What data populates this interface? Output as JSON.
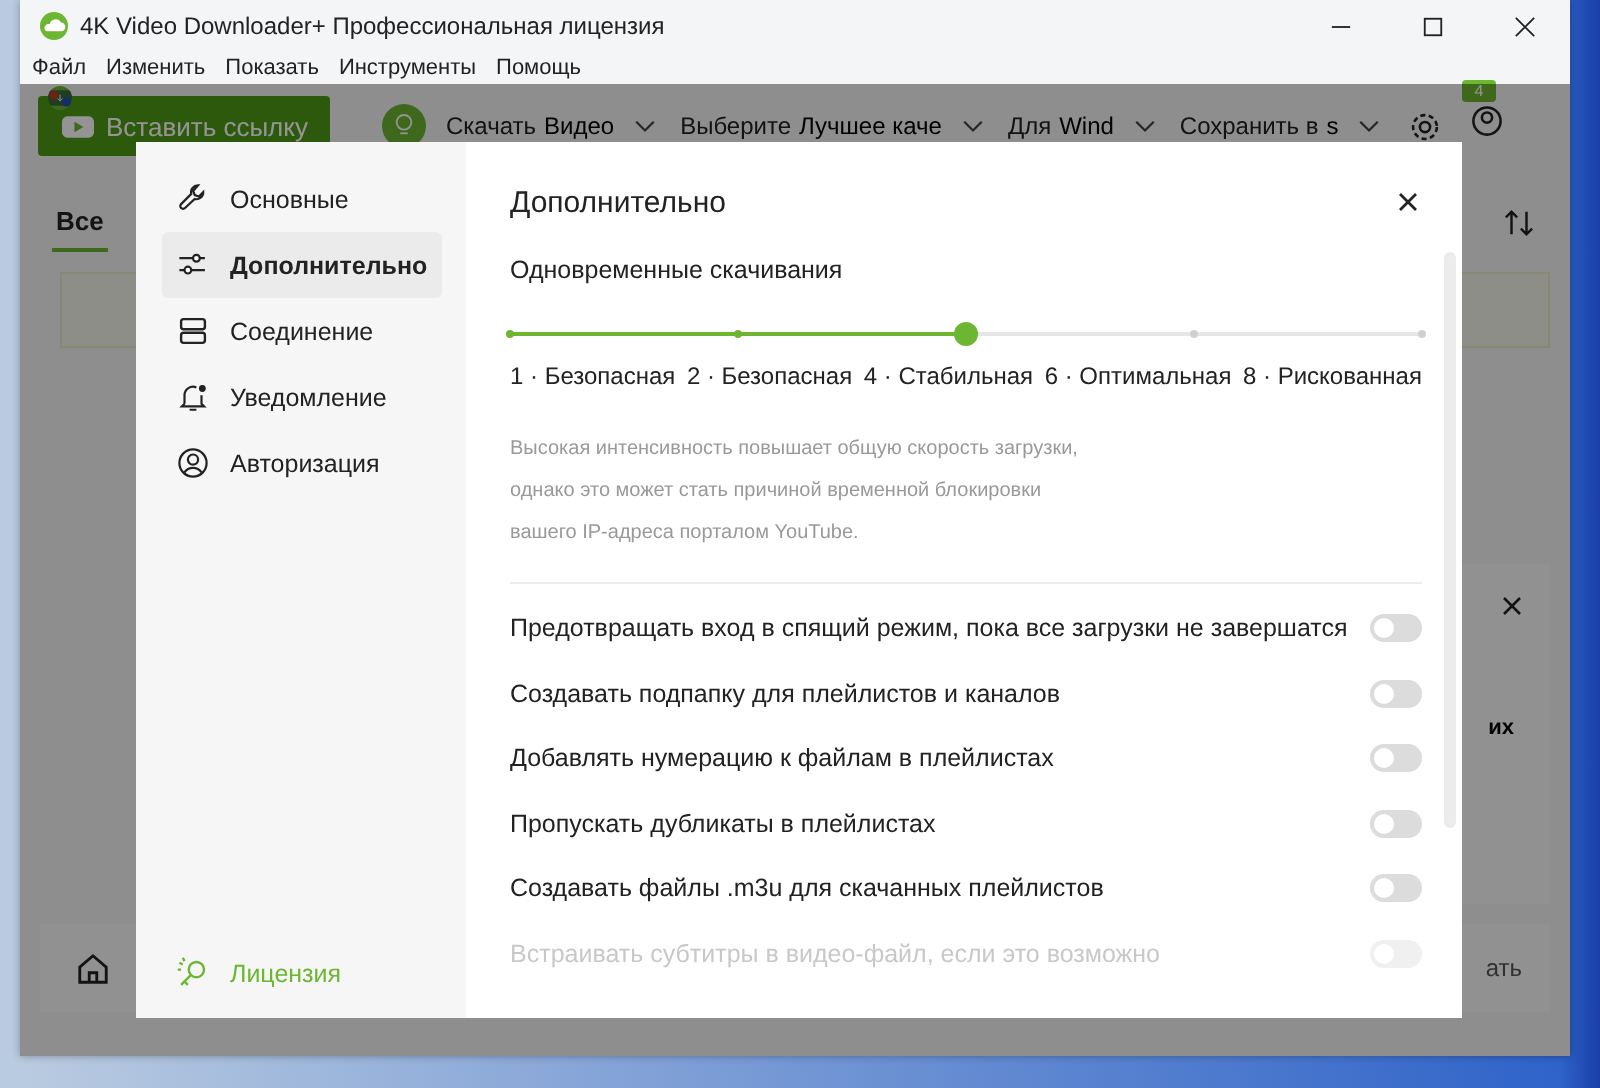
{
  "window": {
    "title": "4K Video Downloader+ Профессиональная лицензия"
  },
  "menu": [
    "Файл",
    "Изменить",
    "Показать",
    "Инструменты",
    "Помощь"
  ],
  "background_app": {
    "paste_button": "Вставить ссылку",
    "options": [
      {
        "label": "Скачать",
        "value": "Видео"
      },
      {
        "label": "Выберите",
        "value": "Лучшее каче"
      },
      {
        "label": "Для",
        "value": "Wind"
      },
      {
        "label": "Сохранить в",
        "value": "s"
      }
    ],
    "badge": "4",
    "tabs": [
      {
        "label": "Все",
        "selected": true
      }
    ],
    "panel_text": "их",
    "bottom_button": "ать"
  },
  "dialog": {
    "sidebar": {
      "items": [
        {
          "label": "Основные",
          "selected": false
        },
        {
          "label": "Дополнительно",
          "selected": true
        },
        {
          "label": "Соединение",
          "selected": false
        },
        {
          "label": "Уведомление",
          "selected": false
        },
        {
          "label": "Авторизация",
          "selected": false
        }
      ],
      "license": "Лицензия"
    },
    "title": "Дополнительно",
    "slider": {
      "label": "Одновременные скачивания",
      "level": 0.5,
      "stops": [
        "1 · Безопасная",
        "2 · Безопасная",
        "4 · Стабильная",
        "6 · Оптимальная",
        "8 · Рискованная"
      ]
    },
    "note": "Высокая интенсивность повышает общую скорость загрузки, однако это может стать причиной временной блокировки вашего IP-адреса порталом YouTube.",
    "toggles": [
      {
        "label": "Предотвращать вход в спящий режим, пока все загрузки не завершатся",
        "on": false,
        "disabled": false
      },
      {
        "label": "Создавать подпапку для плейлистов и каналов",
        "on": false,
        "disabled": false
      },
      {
        "label": "Добавлять нумерацию к файлам в плейлистах",
        "on": false,
        "disabled": false
      },
      {
        "label": "Пропускать дубликаты в плейлистах",
        "on": false,
        "disabled": false
      },
      {
        "label": "Создавать файлы .m3u для скачанных плейлистов",
        "on": false,
        "disabled": false
      },
      {
        "label": "Встраивать субтитры в видео-файл, если это возможно",
        "on": false,
        "disabled": true
      }
    ]
  }
}
